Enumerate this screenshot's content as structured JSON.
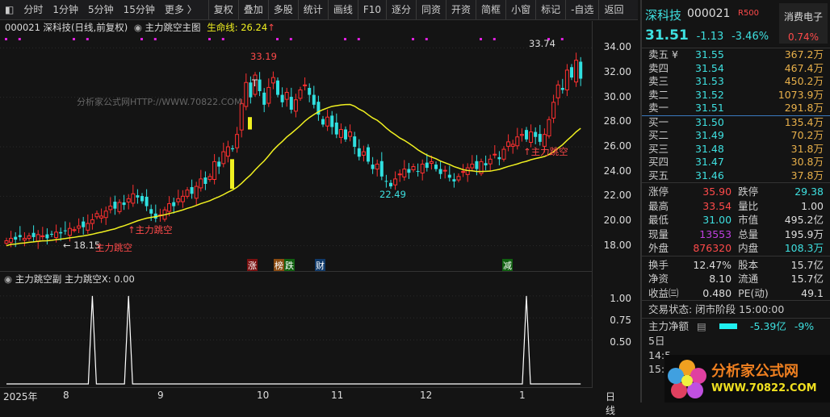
{
  "toolbar": {
    "left": [
      "分时",
      "1分钟",
      "5分钟",
      "15分钟",
      "更多 〉"
    ],
    "buttons": [
      "复权",
      "叠加",
      "多股",
      "统计",
      "画线",
      "F10",
      "逐分",
      "同资",
      "开资",
      "简框",
      "小窗",
      "标记",
      "-自选",
      "返回"
    ]
  },
  "info": {
    "code_title": "000021 深科技(日线,前复权)",
    "indicator": "主力跳空主图",
    "lifeline": "生命线: 26.24",
    "arrow": "↑"
  },
  "sub": {
    "title": "主力跳空副",
    "value": "主力跳空X: 0.00"
  },
  "annotations": {
    "high1": "33.19",
    "high2": "33.74",
    "low1": "22.49",
    "low0": "← 18.15",
    "signal": "主力跳空",
    "t": "T"
  },
  "events": [
    "涨",
    "榜",
    "跌",
    "财",
    "减"
  ],
  "quote": {
    "name": "深科技",
    "code": "000021",
    "badge": "R500",
    "sector": "消费电子",
    "sector_pct": "0.74%",
    "price": "31.51",
    "change": "-1.13",
    "pct": "-3.46%"
  },
  "orderbook": {
    "sell": [
      [
        "卖五 ¥",
        "31.55",
        "367.2万"
      ],
      [
        "卖四",
        "31.54",
        "467.4万"
      ],
      [
        "卖三",
        "31.53",
        "450.2万"
      ],
      [
        "卖二",
        "31.52",
        "1073.9万"
      ],
      [
        "卖一",
        "31.51",
        "291.8万"
      ]
    ],
    "buy": [
      [
        "买一",
        "31.50",
        "135.4万"
      ],
      [
        "买二",
        "31.49",
        "70.2万"
      ],
      [
        "买三",
        "31.48",
        "31.8万"
      ],
      [
        "买四",
        "31.47",
        "30.8万"
      ],
      [
        "买五",
        "31.46",
        "37.8万"
      ]
    ]
  },
  "stats": [
    [
      "涨停",
      "35.90",
      "跌停",
      "29.38"
    ],
    [
      "最高",
      "33.54",
      "量比",
      "1.00"
    ],
    [
      "最低",
      "31.00",
      "市值",
      "495.2亿"
    ],
    [
      "现量",
      "13553",
      "总量",
      "195.9万"
    ],
    [
      "外盘",
      "876320",
      "内盘",
      "108.3万"
    ]
  ],
  "stats2": [
    [
      "换手",
      "12.47%",
      "股本",
      "15.7亿"
    ],
    [
      "净资",
      "8.10",
      "流通",
      "15.7亿"
    ],
    [
      "收益㈢",
      "0.480",
      "PE(动)",
      "49.1"
    ]
  ],
  "status": "交易状态: 闭市阶段 15:00:00",
  "flow": {
    "label": "主力净额",
    "value": "-5.39亿",
    "pct": "-9%",
    "row2": "5日",
    "row3": "14:5",
    "row4": "15:0"
  },
  "logo": {
    "text": "分析家公式网",
    "url": "WWW.70822.COM"
  },
  "watermark": "分析家公式网HTTP://WWW.70822.COM",
  "dates": {
    "year": "2025年",
    "months": [
      "8",
      "9",
      "10",
      "11",
      "12",
      "1"
    ],
    "period": "日线"
  },
  "chart_data": {
    "type": "candlestick",
    "yaxis_ticks": [
      "34.00",
      "32.00",
      "30.00",
      "28.00",
      "26.00",
      "24.00",
      "22.00",
      "20.00",
      "18.00"
    ],
    "ylim": [
      17,
      35
    ],
    "closes": [
      18.4,
      18.6,
      18.5,
      18.7,
      18.6,
      18.8,
      18.7,
      18.9,
      18.8,
      18.6,
      18.9,
      19.1,
      19.0,
      19.2,
      19.4,
      19.3,
      19.6,
      19.5,
      19.8,
      20.1,
      20.6,
      20.4,
      20.8,
      21.2,
      21.0,
      21.5,
      21.3,
      21.8,
      22.2,
      21.9,
      21.6,
      21.2,
      20.6,
      20.2,
      20.5,
      20.9,
      21.4,
      21.2,
      21.8,
      22.0,
      22.5,
      22.2,
      22.8,
      23.4,
      23.0,
      23.6,
      24.8,
      24.4,
      25.6,
      26.0,
      25.8,
      27.0,
      29.5,
      31.2,
      30.0,
      31.8,
      30.5,
      29.4,
      30.8,
      31.6,
      30.2,
      29.6,
      30.4,
      29.0,
      29.8,
      30.6,
      31.0,
      30.2,
      29.4,
      28.6,
      27.8,
      28.4,
      27.6,
      27.0,
      27.4,
      26.6,
      27.2,
      26.0,
      25.2,
      25.6,
      24.8,
      24.2,
      24.6,
      23.6,
      23.2,
      22.8,
      23.4,
      23.8,
      24.2,
      23.9,
      24.4,
      24.0,
      24.6,
      24.3,
      24.8,
      24.2,
      23.8,
      24.1,
      23.5,
      23.2,
      23.6,
      24.0,
      24.3,
      24.6,
      24.2,
      24.8,
      24.5,
      25.0,
      25.4,
      25.0,
      25.8,
      26.4,
      26.2,
      26.8,
      27.0,
      26.6,
      27.2,
      26.8,
      26.4,
      27.0,
      28.2,
      29.6,
      31.0,
      30.6,
      32.2,
      31.6,
      33.0,
      31.51
    ],
    "ma_period": 25,
    "signal_bars": [
      19,
      27,
      115
    ],
    "sub_ticks": [
      "1.00",
      "0.75",
      "0.50"
    ],
    "sub_ylim": [
      0,
      1.1
    ]
  }
}
